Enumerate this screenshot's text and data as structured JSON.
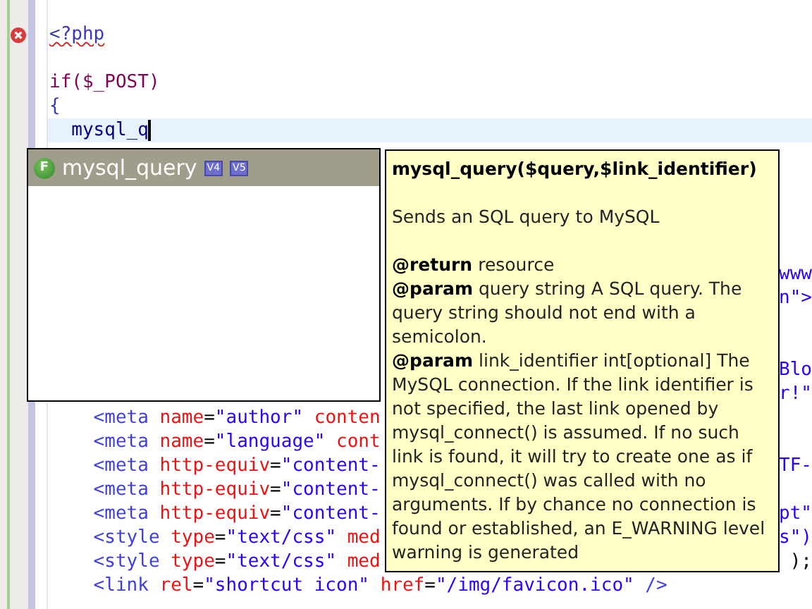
{
  "editor": {
    "lines": [
      {
        "tokens": [
          {
            "text": "<?php",
            "kind": "php"
          }
        ],
        "error": true,
        "current": false
      },
      {
        "error": false,
        "current": false
      },
      {
        "tokens": [
          {
            "text": "if($_POST)",
            "kind": "keyword"
          }
        ],
        "error": false,
        "current": false
      },
      {
        "tokens": [
          {
            "text": "{",
            "kind": "php"
          }
        ],
        "error": false,
        "current": false
      },
      {
        "tokens": [
          {
            "text": "  mysql_q",
            "kind": "ident"
          }
        ],
        "error": false,
        "current": true
      },
      {
        "error": false,
        "current": false
      },
      {
        "error": false,
        "current": false
      },
      {
        "error": false,
        "current": false
      },
      {
        "error": false,
        "current": false
      },
      {
        "error": false,
        "current": false
      },
      {
        "right": [
          {
            "text": "www",
            "kind": "value"
          }
        ],
        "error": false,
        "current": false
      },
      {
        "right": [
          {
            "text": "n\">",
            "kind": "value"
          }
        ],
        "error": false,
        "current": false
      },
      {
        "error": false,
        "current": false
      },
      {
        "error": false,
        "current": false
      },
      {
        "right": [
          {
            "text": "Blo",
            "kind": "value"
          }
        ],
        "error": false,
        "current": false
      },
      {
        "right": [
          {
            "text": "r!\"",
            "kind": "value"
          }
        ],
        "error": false,
        "current": false
      },
      {
        "tokens": [
          {
            "text": "    <meta",
            "kind": "tag"
          },
          {
            "text": " name",
            "kind": "attr"
          },
          {
            "text": "=",
            "kind": "plain"
          },
          {
            "text": "\"author\"",
            "kind": "value"
          },
          {
            "text": " conten",
            "kind": "attr"
          }
        ],
        "error": false,
        "current": false
      },
      {
        "tokens": [
          {
            "text": "    <meta",
            "kind": "tag"
          },
          {
            "text": " name",
            "kind": "attr"
          },
          {
            "text": "=",
            "kind": "plain"
          },
          {
            "text": "\"language\"",
            "kind": "value"
          },
          {
            "text": " cont",
            "kind": "attr"
          }
        ],
        "error": false,
        "current": false
      },
      {
        "tokens": [
          {
            "text": "    <meta",
            "kind": "tag"
          },
          {
            "text": " http-equiv",
            "kind": "attr"
          },
          {
            "text": "=",
            "kind": "plain"
          },
          {
            "text": "\"content-",
            "kind": "value"
          }
        ],
        "right": [
          {
            "text": "TF-",
            "kind": "value"
          }
        ],
        "error": false,
        "current": false
      },
      {
        "tokens": [
          {
            "text": "    <meta",
            "kind": "tag"
          },
          {
            "text": " http-equiv",
            "kind": "attr"
          },
          {
            "text": "=",
            "kind": "plain"
          },
          {
            "text": "\"content-",
            "kind": "value"
          }
        ],
        "error": false,
        "current": false
      },
      {
        "tokens": [
          {
            "text": "    <meta",
            "kind": "tag"
          },
          {
            "text": " http-equiv",
            "kind": "attr"
          },
          {
            "text": "=",
            "kind": "plain"
          },
          {
            "text": "\"content-",
            "kind": "value"
          }
        ],
        "right": [
          {
            "text": "pt\"",
            "kind": "value"
          }
        ],
        "error": false,
        "current": false
      },
      {
        "tokens": [
          {
            "text": "    <style",
            "kind": "tag"
          },
          {
            "text": " type",
            "kind": "attr"
          },
          {
            "text": "=",
            "kind": "plain"
          },
          {
            "text": "\"text/css\"",
            "kind": "value"
          },
          {
            "text": " med",
            "kind": "attr"
          }
        ],
        "right": [
          {
            "text": "s\")",
            "kind": "value"
          }
        ],
        "error": false,
        "current": false
      },
      {
        "tokens": [
          {
            "text": "    <style",
            "kind": "tag"
          },
          {
            "text": " type",
            "kind": "attr"
          },
          {
            "text": "=",
            "kind": "plain"
          },
          {
            "text": "\"text/css\"",
            "kind": "value"
          },
          {
            "text": " med",
            "kind": "attr"
          }
        ],
        "right": [
          {
            "text": ");",
            "kind": "plain"
          }
        ],
        "error": false,
        "current": false
      },
      {
        "tokens": [
          {
            "text": "    <link",
            "kind": "tag"
          },
          {
            "text": " rel",
            "kind": "attr"
          },
          {
            "text": "=",
            "kind": "plain"
          },
          {
            "text": "\"shortcut icon\"",
            "kind": "value"
          },
          {
            "text": " href",
            "kind": "attr"
          },
          {
            "text": "=",
            "kind": "plain"
          },
          {
            "text": "\"/img/favicon.ico\"",
            "kind": "value"
          },
          {
            "text": " />",
            "kind": "tag"
          }
        ],
        "error": false,
        "current": false
      }
    ]
  },
  "completion": {
    "items": [
      {
        "label": "mysql_query",
        "kind": "function",
        "icon_letter": "F",
        "selected": true,
        "badges": [
          "V4",
          "V5"
        ]
      }
    ]
  },
  "tooltip": {
    "title": "mysql_query($query,$link_identifier)",
    "description": "Sends an SQL query to MySQL",
    "entries": [
      {
        "tag": "@return",
        "text": "resource"
      },
      {
        "tag": "@param",
        "text": "query string A SQL query. The query string should not end with a semicolon."
      },
      {
        "tag": "@param",
        "text": "link_identifier int[optional] The MySQL connection. If the link identifier is not specified, the last link opened by mysql_connect() is assumed. If no such link is found, it will try to create one as if mysql_connect() was called with no arguments. If by chance no connection is found or established, an E_WARNING level warning is generated"
      }
    ]
  }
}
